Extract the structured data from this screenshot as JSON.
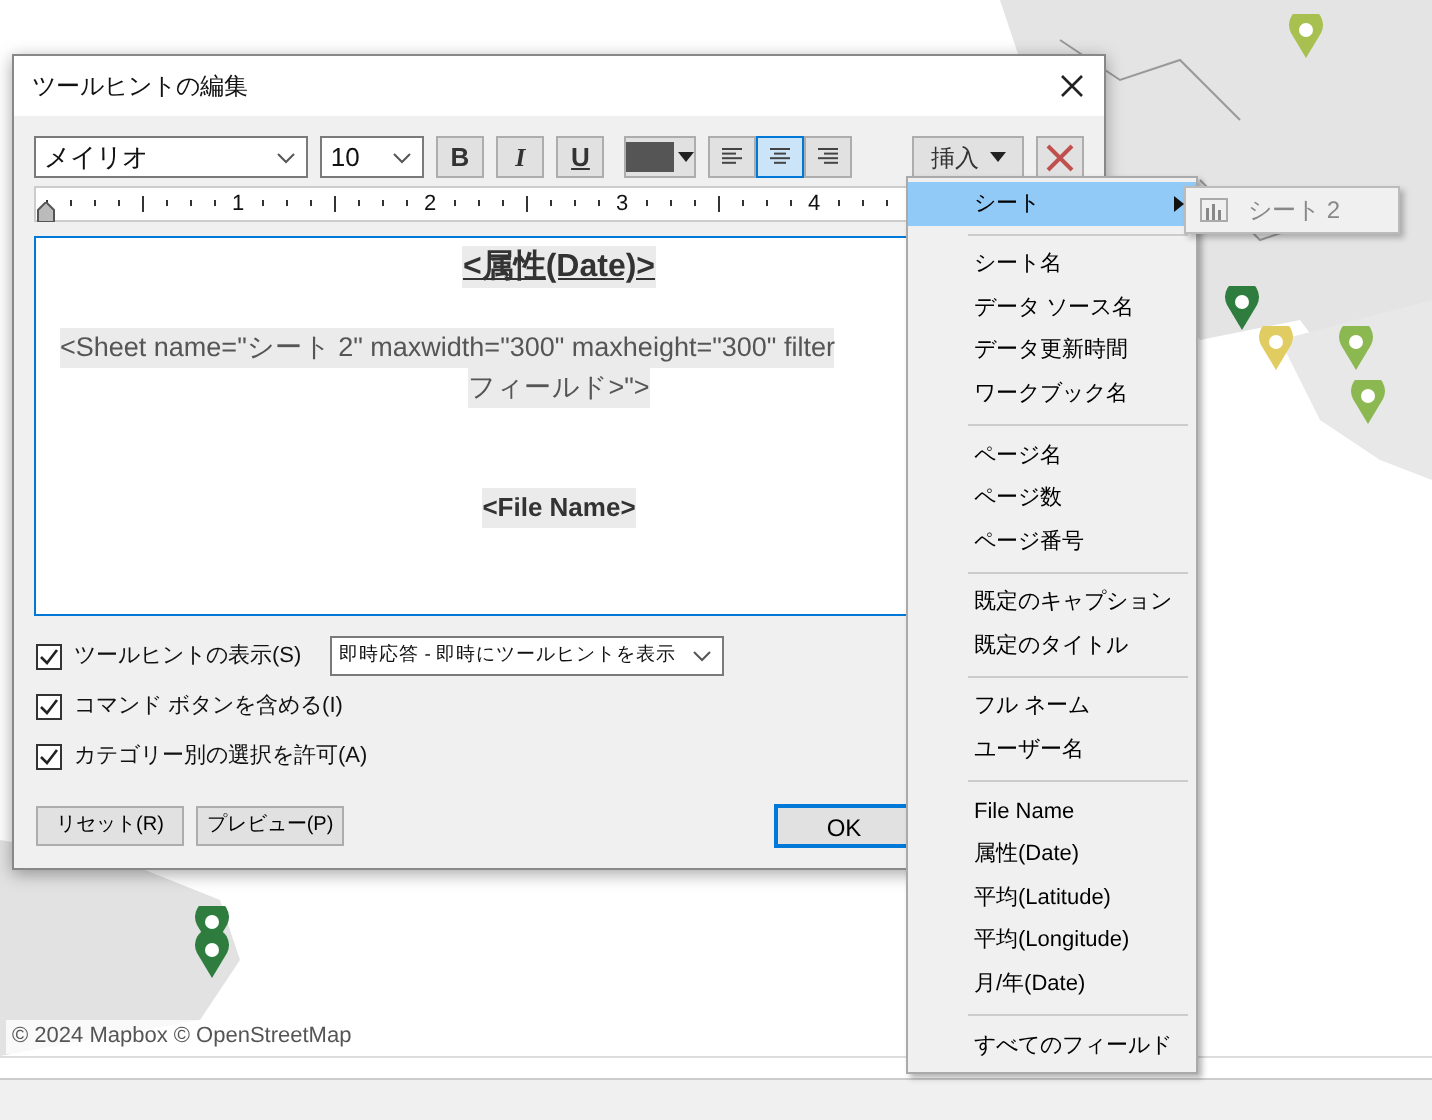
{
  "dialog": {
    "title": "ツールヒントの編集",
    "toolbar": {
      "font": "メイリオ",
      "size": "10",
      "bold": "B",
      "italic": "I",
      "underline": "U",
      "align": [
        {
          "kind": "left",
          "selected": false
        },
        {
          "kind": "center",
          "selected": true
        },
        {
          "kind": "right",
          "selected": false
        }
      ],
      "insert": "挿入"
    },
    "ruler": [
      "1",
      "2",
      "3",
      "4"
    ],
    "editor": [
      {
        "kind": "heading",
        "text": "<属性(Date)>"
      },
      {
        "kind": "sheet",
        "lines": [
          "<Sheet name=\"シート 2\" maxwidth=\"300\" maxheight=\"300\" filter",
          "フィールド>\">"
        ]
      },
      {
        "kind": "field",
        "text": "<File Name>"
      }
    ],
    "options": [
      {
        "label": "ツールヒントの表示(S)",
        "checked": true,
        "select": "即時応答 - 即時にツールヒントを表示"
      },
      {
        "label": "コマンド ボタンを含める(I)",
        "checked": true
      },
      {
        "label": "カテゴリー別の選択を許可(A)",
        "checked": true
      }
    ],
    "buttons": [
      "リセット(R)",
      "プレビュー(P)"
    ],
    "ok": "OK"
  },
  "menu": {
    "groups": [
      [
        {
          "label": "シート",
          "kind": "submenu",
          "selected": true
        }
      ],
      [
        {
          "label": "シート名",
          "kind": "item",
          "selected": false
        },
        {
          "label": "データ ソース名",
          "kind": "item",
          "selected": false
        },
        {
          "label": "データ更新時間",
          "kind": "item",
          "selected": false
        },
        {
          "label": "ワークブック名",
          "kind": "item",
          "selected": false
        }
      ],
      [
        {
          "label": "ページ名",
          "kind": "item",
          "selected": false
        },
        {
          "label": "ページ数",
          "kind": "item",
          "selected": false
        },
        {
          "label": "ページ番号",
          "kind": "item",
          "selected": false
        }
      ],
      [
        {
          "label": "既定のキャプション",
          "kind": "item",
          "selected": false
        },
        {
          "label": "既定のタイトル",
          "kind": "item",
          "selected": false
        }
      ],
      [
        {
          "label": "フル ネーム",
          "kind": "item",
          "selected": false
        },
        {
          "label": "ユーザー名",
          "kind": "item",
          "selected": false
        }
      ],
      [
        {
          "label": "File Name",
          "kind": "item",
          "selected": false
        },
        {
          "label": "属性(Date)",
          "kind": "item",
          "selected": false
        },
        {
          "label": "平均(Latitude)",
          "kind": "item",
          "selected": false
        },
        {
          "label": "平均(Longitude)",
          "kind": "item",
          "selected": false
        },
        {
          "label": "月/年(Date)",
          "kind": "item",
          "selected": false
        }
      ],
      [
        {
          "label": "すべてのフィールド",
          "kind": "item",
          "selected": false
        }
      ]
    ]
  },
  "submenu": {
    "items": [
      {
        "label": "シート 2",
        "disabled": true
      }
    ]
  },
  "map": {
    "kind": "picture",
    "attribution": "© 2024 Mapbox © OpenStreetMap"
  }
}
